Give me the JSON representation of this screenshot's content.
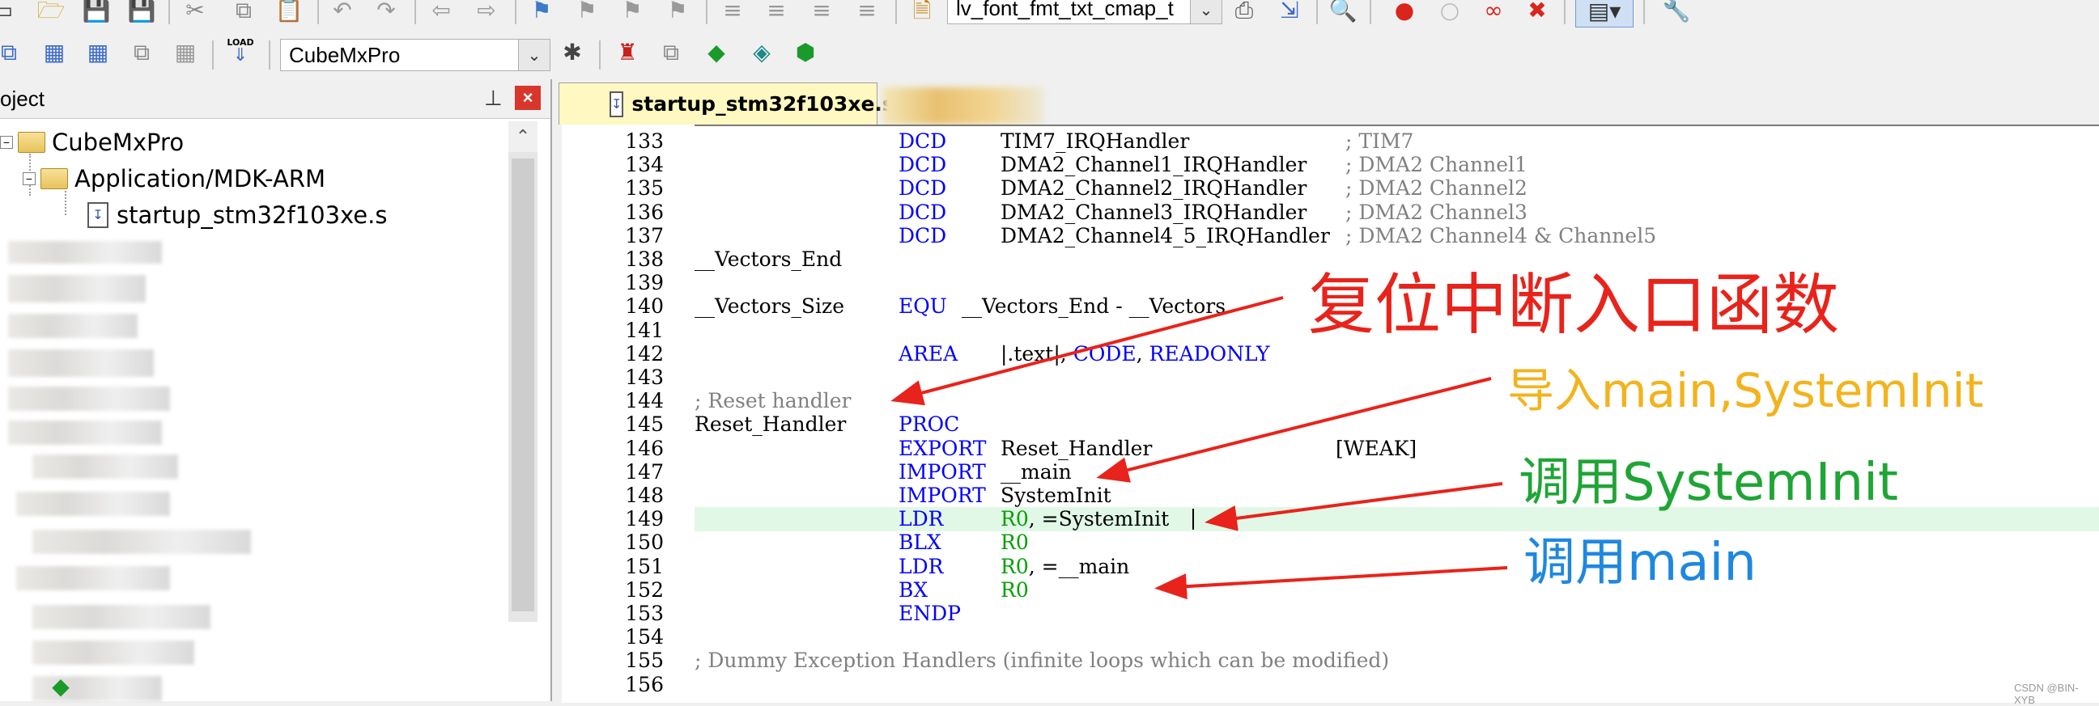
{
  "toolbar": {
    "target_combo": "lv_font_fmt_txt_cmap_t",
    "project_combo": "CubeMxPro",
    "load_icon_label": "LOAD"
  },
  "panel": {
    "title": "oject",
    "pin_icon": "pin-icon",
    "close_icon": "close-icon",
    "tree": {
      "root": "CubeMxPro",
      "group": "Application/MDK-ARM",
      "file": "startup_stm32f103xe.s"
    }
  },
  "editor": {
    "tab": "startup_stm32f103xe.s",
    "lines": [
      {
        "n": "133",
        "label": "",
        "op": "DCD",
        "arg": "TIM7_IRQHandler",
        "comment": "; TIM7"
      },
      {
        "n": "134",
        "label": "",
        "op": "DCD",
        "arg": "DMA2_Channel1_IRQHandler",
        "comment": "; DMA2 Channel1"
      },
      {
        "n": "135",
        "label": "",
        "op": "DCD",
        "arg": "DMA2_Channel2_IRQHandler",
        "comment": "; DMA2 Channel2"
      },
      {
        "n": "136",
        "label": "",
        "op": "DCD",
        "arg": "DMA2_Channel3_IRQHandler",
        "comment": "; DMA2 Channel3"
      },
      {
        "n": "137",
        "label": "",
        "op": "DCD",
        "arg": "DMA2_Channel4_5_IRQHandler",
        "comment": "; DMA2 Channel4 & Channel5"
      },
      {
        "n": "138",
        "label": "__Vectors_End",
        "op": "",
        "arg": "",
        "comment": ""
      },
      {
        "n": "139",
        "label": "",
        "op": "",
        "arg": "",
        "comment": ""
      },
      {
        "n": "140",
        "label": "__Vectors_Size",
        "op": "EQU",
        "arg": "__Vectors_End - __Vectors",
        "comment": ""
      },
      {
        "n": "141",
        "label": "",
        "op": "",
        "arg": "",
        "comment": ""
      },
      {
        "n": "142",
        "label": "",
        "op": "AREA",
        "arg": "|.text|, CODE, READONLY",
        "comment": ""
      },
      {
        "n": "143",
        "label": "",
        "op": "",
        "arg": "",
        "comment": ""
      },
      {
        "n": "144",
        "label": "; Reset handler",
        "op": "",
        "arg": "",
        "comment": ""
      },
      {
        "n": "145",
        "label": "Reset_Handler",
        "op": "PROC",
        "arg": "",
        "comment": ""
      },
      {
        "n": "146",
        "label": "",
        "op": "EXPORT",
        "arg": "Reset_Handler",
        "comment": "[WEAK]"
      },
      {
        "n": "147",
        "label": "",
        "op": "IMPORT",
        "arg": "__main",
        "comment": ""
      },
      {
        "n": "148",
        "label": "",
        "op": "IMPORT",
        "arg": "SystemInit",
        "comment": ""
      },
      {
        "n": "149",
        "label": "",
        "op": "LDR",
        "arg": "R0, =SystemInit",
        "comment": ""
      },
      {
        "n": "150",
        "label": "",
        "op": "BLX",
        "arg": "R0",
        "comment": ""
      },
      {
        "n": "151",
        "label": "",
        "op": "LDR",
        "arg": "R0, =__main",
        "comment": ""
      },
      {
        "n": "152",
        "label": "",
        "op": "BX",
        "arg": "R0",
        "comment": ""
      },
      {
        "n": "153",
        "label": "",
        "op": "ENDP",
        "arg": "",
        "comment": ""
      },
      {
        "n": "154",
        "label": "",
        "op": "",
        "arg": "",
        "comment": ""
      },
      {
        "n": "155",
        "label": "; Dummy Exception Handlers (infinite loops which can be modified)",
        "op": "",
        "arg": "",
        "comment": ""
      },
      {
        "n": "156",
        "label": "",
        "op": "",
        "arg": "",
        "comment": ""
      }
    ]
  },
  "annotations": {
    "reset_entry": "复位中断入口函数",
    "import": "导入main,SystemInit",
    "call_systeminit": "调用SystemInit",
    "call_main": "调用main",
    "arrow_color": "#e8231b"
  },
  "watermark": "CSDN @BIN-XYB"
}
